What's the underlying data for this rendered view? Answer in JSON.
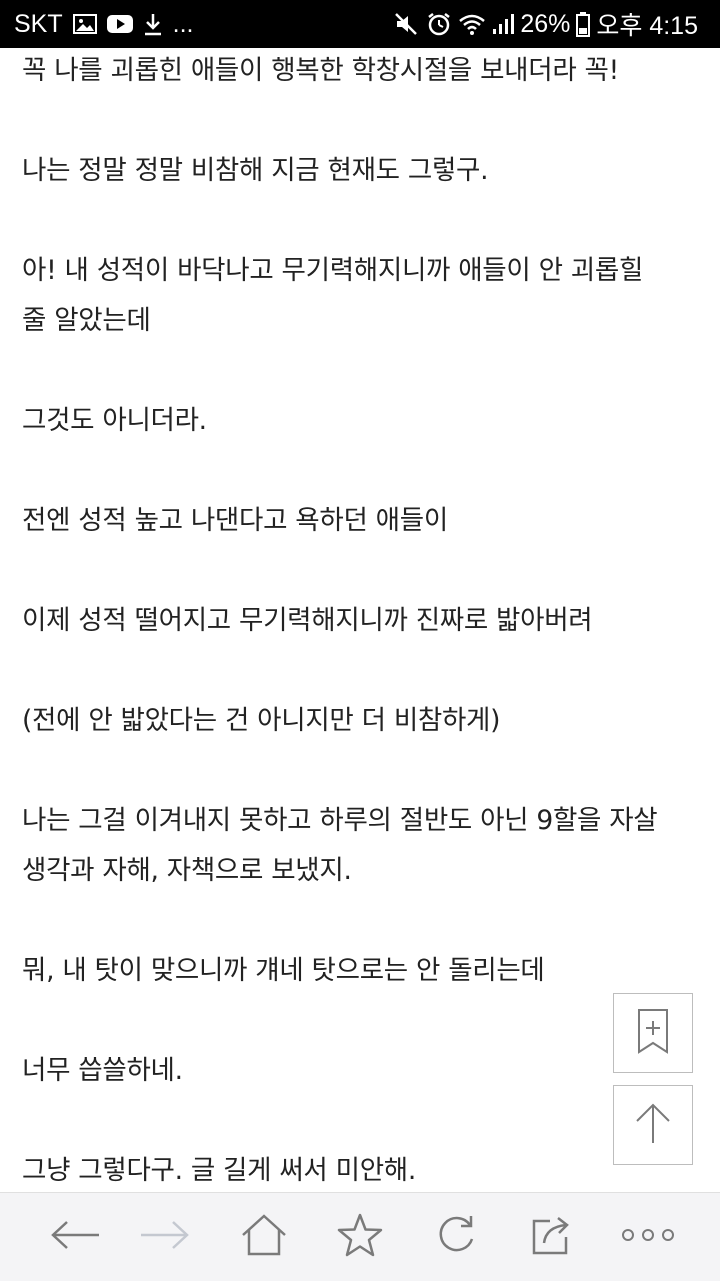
{
  "status_bar": {
    "carrier": "SKT",
    "more": "...",
    "battery": "26%",
    "time": "오후 4:15"
  },
  "article": {
    "lines": [
      "꼭 나를 괴롭힌 애들이 행복한 학창시절을 보내더라 꼭!",
      "나는 정말 정말 비참해 지금 현재도 그렇구.",
      "아! 내 성적이 바닥나고 무기력해지니까 애들이 안 괴롭힐",
      "줄 알았는데",
      "그것도 아니더라.",
      "전엔 성적 높고 나댄다고 욕하던 애들이",
      "이제 성적 떨어지고 무기력해지니까 진짜로 밟아버려",
      "(전에 안 밟았다는 건 아니지만 더 비참하게)",
      "나는 그걸 이겨내지 못하고 하루의 절반도 아닌 9할을 자살",
      "생각과 자해, 자책으로 보냈지.",
      "뭐, 내 탓이 맞으니까 걔네 탓으로는 안 돌리는데",
      "너무 씁쓸하네.",
      "그냥 그렇다구. 글 길게 써서 미안해."
    ]
  },
  "colors": {
    "text": "#222222",
    "status_bg": "#000000",
    "toolbar_bg": "#f4f4f6",
    "icon": "#7a7a7a",
    "icon_disabled": "#c4c8d0"
  },
  "icons": {
    "bookmark_add": "bookmark-add-icon",
    "scroll_top": "arrow-up-icon",
    "back": "arrow-left-icon",
    "forward": "arrow-right-icon",
    "home": "home-icon",
    "favorite": "star-icon",
    "refresh": "refresh-icon",
    "share": "share-icon",
    "more": "more-icon"
  }
}
